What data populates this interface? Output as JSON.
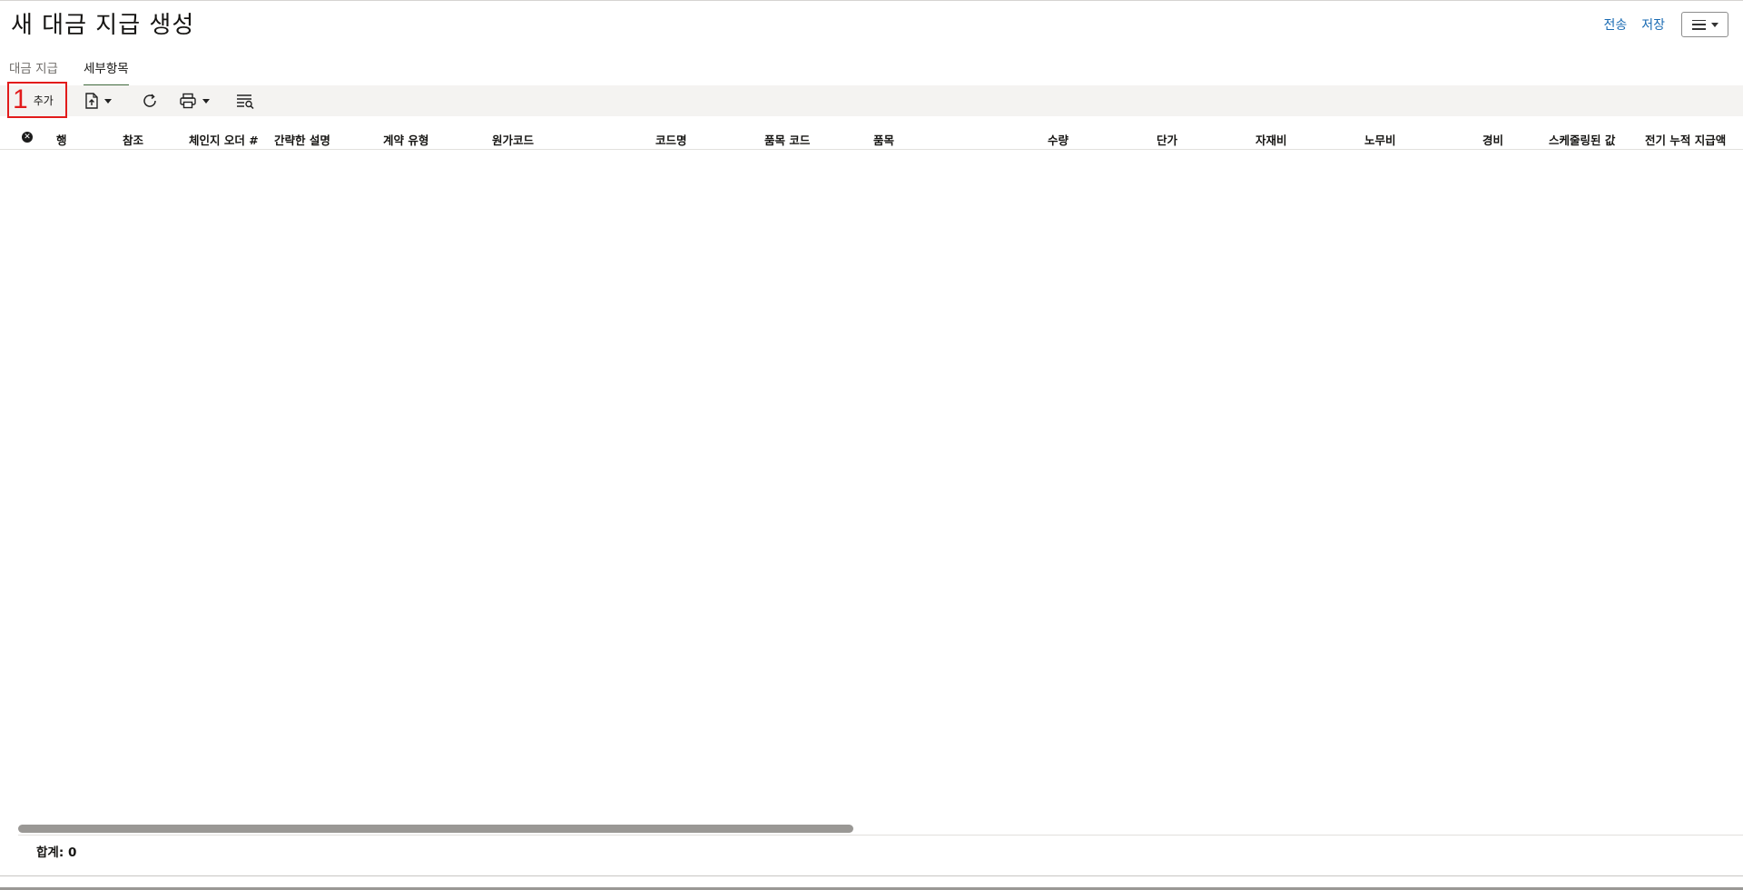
{
  "header": {
    "title": "새 대금 지급 생성",
    "send_label": "전송",
    "save_label": "저장"
  },
  "tabs": [
    {
      "label": "대금 지급",
      "active": false
    },
    {
      "label": "세부항목",
      "active": true
    }
  ],
  "toolbar": {
    "add_number": "1",
    "add_label": "추가"
  },
  "grid": {
    "columns": [
      "행",
      "참조",
      "체인지 오더 #",
      "간략한 설명",
      "계약 유형",
      "원가코드",
      "코드명",
      "품목 코드",
      "품목",
      "수량",
      "단가",
      "자재비",
      "노무비",
      "경비",
      "스케줄링된 값",
      "전기 누적 지급액"
    ],
    "rows": []
  },
  "footer": {
    "total_label": "합계: 0"
  },
  "colors": {
    "accent": "#1a6bb3",
    "highlight": "#e21b1b",
    "active_tab": "#3f6a3c",
    "toolbar_bg": "#f4f3f1"
  }
}
